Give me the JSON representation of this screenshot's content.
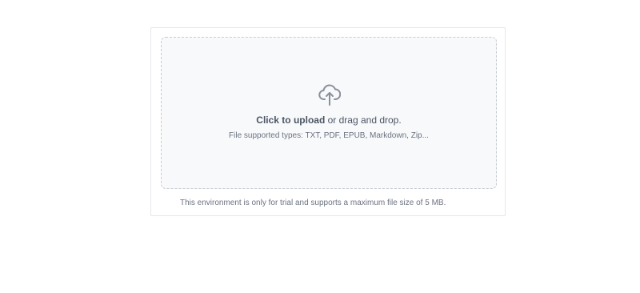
{
  "upload": {
    "icon": "cloud-upload-icon",
    "click_label": "Click to upload",
    "drag_label": " or drag and drop.",
    "supported_types": "File supported types: TXT, PDF, EPUB, Markdown, Zip..."
  },
  "note": "This environment is only for trial and supports a maximum file size of 5 MB.",
  "colors": {
    "dropzone_background": "#f8f9fb",
    "dropzone_border": "#c7ccd4",
    "text_primary": "#4b5563",
    "text_secondary": "#6b7280"
  }
}
